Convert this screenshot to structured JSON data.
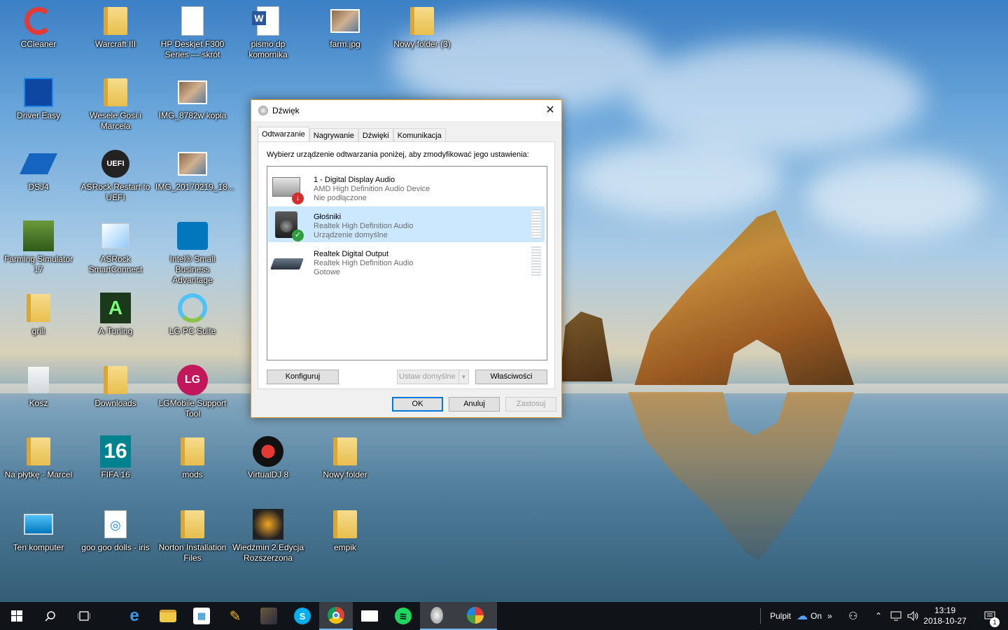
{
  "desktop": {
    "icons": [
      {
        "label": "CCleaner",
        "icon": "ccleaner-icon"
      },
      {
        "label": "Warcraft III",
        "icon": "folder-icon"
      },
      {
        "label": "HP Deskjet F300 Series — skrót",
        "icon": "document-icon"
      },
      {
        "label": "pismo dp komornika",
        "icon": "word-document-icon"
      },
      {
        "label": "farm.jpg",
        "icon": "image-icon"
      },
      {
        "label": "Nowy folder (3)",
        "icon": "folder-icon"
      },
      {
        "label": "Driver Easy",
        "icon": "driver-easy-icon"
      },
      {
        "label": "Wesele Gosi i Marcela",
        "icon": "folder-icon"
      },
      {
        "label": "IMG_8782w kopia",
        "icon": "image-icon"
      },
      {
        "label": "DSJ4",
        "icon": "dsj4-icon"
      },
      {
        "label": "ASRock Restart to UEFI",
        "icon": "uefi-icon"
      },
      {
        "label": "IMG_20170219_18...",
        "icon": "image-icon"
      },
      {
        "label": "Farming Simulator 17",
        "icon": "farming-simulator-icon"
      },
      {
        "label": "ASRock SmartConnect",
        "icon": "asrock-icon"
      },
      {
        "label": "Intel® Small Business Advantage",
        "icon": "intel-briefcase-icon"
      },
      {
        "label": "grill",
        "icon": "folder-icon"
      },
      {
        "label": "A-Tuning",
        "icon": "a-tuning-icon"
      },
      {
        "label": "LG PC Suite",
        "icon": "lg-pc-suite-icon"
      },
      {
        "label": "Kosz",
        "icon": "recycle-bin-icon"
      },
      {
        "label": "Downloads",
        "icon": "folder-icon"
      },
      {
        "label": "LGMobile Support Tool",
        "icon": "lg-icon"
      },
      {
        "label": "Na płytkę - Marcel",
        "icon": "folder-icon"
      },
      {
        "label": "FIFA 16",
        "icon": "fifa-icon"
      },
      {
        "label": "mods",
        "icon": "folder-icon"
      },
      {
        "label": "VirtualDJ 8",
        "icon": "virtualdj-icon"
      },
      {
        "label": "Nowy folder",
        "icon": "folder-icon"
      },
      {
        "label": "Ten komputer",
        "icon": "computer-icon"
      },
      {
        "label": "goo goo dolls - iris",
        "icon": "media-icon"
      },
      {
        "label": "Norton Installation Files",
        "icon": "folder-icon"
      },
      {
        "label": "Wiedźmin 2 Edycja Rozszerzona",
        "icon": "witcher-icon"
      },
      {
        "label": "empik",
        "icon": "folder-icon"
      }
    ]
  },
  "dialog": {
    "title": "Dźwięk",
    "close_glyph": "✕",
    "tabs": [
      "Odtwarzanie",
      "Nagrywanie",
      "Dźwięki",
      "Komunikacja"
    ],
    "active_tab": "Odtwarzanie",
    "instruction": "Wybierz urządzenie odtwarzania poniżej, aby zmodyfikować jego ustawienia:",
    "devices": [
      {
        "name": "1 - Digital Display Audio",
        "driver": "AMD High Definition Audio Device",
        "status": "Nie podłączone",
        "badge": "↓",
        "badge_color": "#d32f2f",
        "selected": false
      },
      {
        "name": "Głośniki",
        "driver": "Realtek High Definition Audio",
        "status": "Urządzenie domyślne",
        "badge": "✓",
        "badge_color": "#2e9e3e",
        "selected": true
      },
      {
        "name": "Realtek Digital Output",
        "driver": "Realtek High Definition Audio",
        "status": "Gotowe",
        "badge": "",
        "badge_color": "",
        "selected": false
      }
    ],
    "buttons": {
      "configure": "Konfiguruj",
      "set_default": "Ustaw domyślne",
      "properties": "Właściwości",
      "ok": "OK",
      "cancel": "Anuluj",
      "apply": "Zastosuj"
    }
  },
  "taskbar": {
    "pinned": [
      "start",
      "search",
      "task-view",
      "edge",
      "file-explorer",
      "store",
      "app-1",
      "app-2",
      "skype",
      "chrome",
      "mail",
      "spotify",
      "sound",
      "photos"
    ],
    "tray": {
      "desktop_label": "Pulpit",
      "onedrive_label": "On",
      "overflow_glyph": "»",
      "time": "13:19",
      "date": "2018-10-27",
      "notification_count": "1"
    }
  },
  "colors": {
    "accent": "#0078d7",
    "selection": "#cce8ff",
    "taskbar": "#101418",
    "dialog_border": "#e0a030"
  }
}
